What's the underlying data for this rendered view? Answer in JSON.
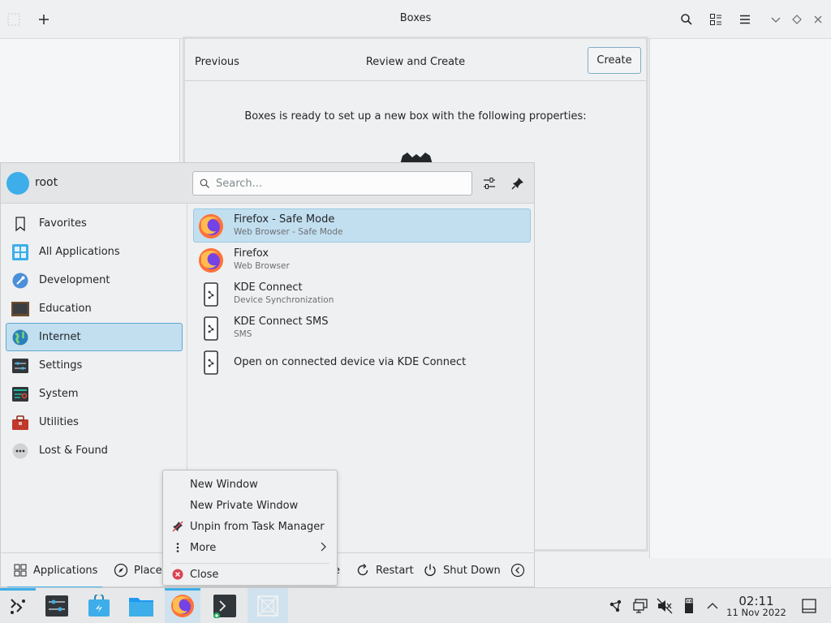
{
  "window": {
    "title": "Boxes"
  },
  "dialog": {
    "previous_label": "Previous",
    "title": "Review and Create",
    "create_label": "Create",
    "message": "Boxes is ready to set up a new box with the following properties:"
  },
  "launcher": {
    "username": "root",
    "search_placeholder": "Search...",
    "categories": [
      {
        "label": "Favorites",
        "icon": "bookmark-icon",
        "selected": false
      },
      {
        "label": "All Applications",
        "icon": "grid-apps-icon",
        "selected": false
      },
      {
        "label": "Development",
        "icon": "development-icon",
        "selected": false
      },
      {
        "label": "Education",
        "icon": "education-icon",
        "selected": false
      },
      {
        "label": "Internet",
        "icon": "globe-icon",
        "selected": true
      },
      {
        "label": "Settings",
        "icon": "settings-icon",
        "selected": false
      },
      {
        "label": "System",
        "icon": "system-icon",
        "selected": false
      },
      {
        "label": "Utilities",
        "icon": "toolbox-icon",
        "selected": false
      },
      {
        "label": "Lost & Found",
        "icon": "more-dots-icon",
        "selected": false
      }
    ],
    "apps": [
      {
        "name": "Firefox - Safe Mode",
        "subtitle": "Web Browser - Safe Mode",
        "icon": "firefox-icon",
        "selected": true
      },
      {
        "name": "Firefox",
        "subtitle": "Web Browser",
        "icon": "firefox-icon",
        "selected": false
      },
      {
        "name": "KDE Connect",
        "subtitle": "Device Synchronization",
        "icon": "kdeconnect-icon",
        "selected": false
      },
      {
        "name": "KDE Connect SMS",
        "subtitle": "SMS",
        "icon": "kdeconnect-icon",
        "selected": false
      },
      {
        "name": "Open on connected device via KDE Connect",
        "subtitle": "",
        "icon": "kdeconnect-icon",
        "selected": false
      }
    ],
    "footer": {
      "applications": "Applications",
      "places": "Places",
      "sleep_fragment": "e",
      "restart": "Restart",
      "shutdown": "Shut Down"
    }
  },
  "context_menu": {
    "items": [
      {
        "label": "New Window",
        "icon": ""
      },
      {
        "label": "New Private Window",
        "icon": ""
      },
      {
        "label": "Unpin from Task Manager",
        "icon": "unpin-icon"
      },
      {
        "label": "More",
        "icon": "more-vertical-icon"
      },
      {
        "label": "Close",
        "icon": "close-icon"
      }
    ]
  },
  "taskbar": {
    "clock_time": "02:11",
    "clock_date": "11 Nov 2022"
  },
  "colors": {
    "accent": "#3daee9",
    "selection": "#c2dff0",
    "background": "#eff0f1"
  }
}
